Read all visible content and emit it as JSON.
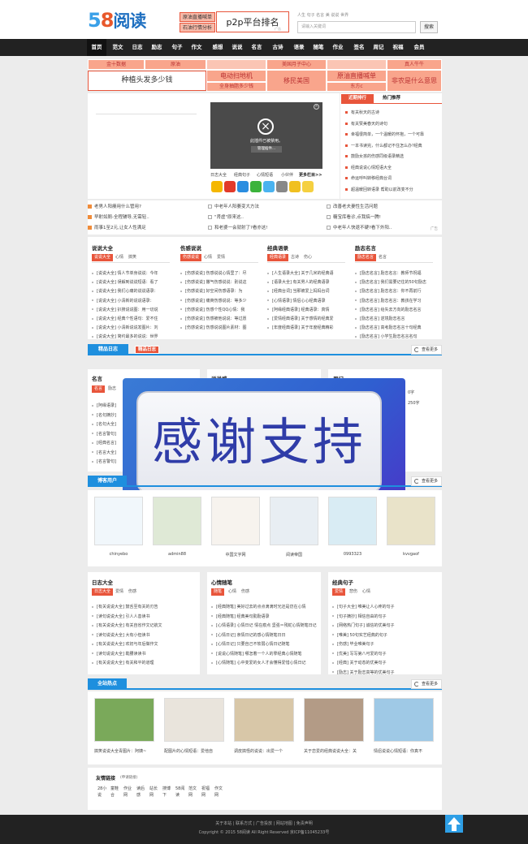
{
  "header": {
    "logo_num1": "5",
    "logo_num2": "8",
    "logo_word": "阅读",
    "ad1": "原油直播喊单",
    "ad2": "石油行情分析",
    "p2p": "p2p平台排名",
    "p2p_ad": "广告",
    "hot_words": "人生  句子  名言  美  说说  世界",
    "search_placeholder": "请输入关键词",
    "search_button": "搜索"
  },
  "nav": [
    "首页",
    "范文",
    "日志",
    "励志",
    "句子",
    "作文",
    "感想",
    "说说",
    "名言",
    "古诗",
    "语录",
    "随笔",
    "作业",
    "签名",
    "周记",
    "祝福",
    "会员"
  ],
  "ads_top": {
    "row1": [
      "金十数据",
      "原油",
      "美国月子中心",
      "真人牛牛"
    ],
    "big_left": "种植头发多少钱",
    "mid": [
      "电动扫地机",
      "移民美国",
      "原油直播喊单",
      "非农是什么意思"
    ],
    "row3": [
      "全身抽脂多少钱",
      "东方c"
    ]
  },
  "video": {
    "blocked": "此插件已被禁用。",
    "manage": "管理插件...",
    "links": [
      "日志大全",
      "经典句子",
      "心情短语",
      "小伙伴"
    ],
    "more": "更多栏目>>"
  },
  "rank": {
    "tab_on": "近期排行",
    "tab_off": "热门推荐",
    "items": [
      "有关秋天的古诗",
      "有关赞美春天的诗句",
      "幸福很简单，一个温暖的怀抱，一个可靠",
      "一本书读完，什么都记不住怎么办?经典",
      "鼓励女孩的伤感同级语录精选",
      "经典说说心情短语大全",
      "命运呼叫转移经典台词",
      "超温暖回转语录 帮助以前改变不分"
    ]
  },
  "headlines": {
    "col1": [
      "老男人阳痿用什么管用?",
      "早射如厕-全程辅导,无需轻..",
      "雨事1至2元,让女人性满足"
    ],
    "col2": [
      "中老年人阳萎变大方法",
      "\"肾虚\"原来这..",
      "和老婆一会就射了?看亦这!"
    ],
    "col3": [
      "改善老夫妻性生活问题",
      "糖宝库看诊,点我搞一腾!",
      "中老年人快退不硬?看下外阳.."
    ],
    "ad": "广告"
  },
  "cat_sections": [
    {
      "title": "说说大全",
      "tags": [
        "说说大全",
        "心情",
        "搞笑"
      ],
      "items": [
        "[说说大全] 情人节单身说说：今年",
        "[说说大全] 误解到说说短语：看了",
        "[说说大全] 我们心痛的说说语录：",
        "[说说大全] 小清新的说说语录：",
        "[说说大全] 扒搜说说图：用一切说",
        "[说说大全] 经典个性语句：爱不住",
        "[说说大全] 小清新说说发图片：刘",
        "[说说大全] 简约最多的说说：世界"
      ]
    },
    {
      "title": "伤感说说",
      "tags": [
        "伤感说说",
        "心情",
        "爱情"
      ],
      "items": [
        "[伤感说说] 伤感说说心情里了：尽",
        "[伤感说说] 撒气伤感说说：别说这",
        "[伤感说说] 好空间伤感语录：为",
        "[伤感说说] 痛爽伤感说说：等多少",
        "[伤感说说] 伤感个性QQ心情：我",
        "[伤感说说] 伤感被他说说：等过愿",
        "[伤感说说] 伤感说说图片素材：图"
      ]
    },
    {
      "title": "经典语录",
      "tags": [
        "经典语录",
        "古诗",
        "伤心"
      ],
      "items": [
        "[人生语录大全] 关于几米的经典语",
        "[语录大全] 有关男人的经典语录",
        "[经典台词] 当那被爱上妈妈台词",
        "[心情语录] 情侣心心经典语录",
        "[阿缘经典语录] 经典语录：真情",
        "[爱情经典语录] 关于感情的经典爱",
        "[年度经典语录] 关于年度经典精彩"
      ]
    },
    {
      "title": "励志名言",
      "tags": [
        "励志名言",
        "名言"
      ],
      "items": [
        "[励志名言] 励志名言：教师节祝福",
        "[励志名言] 我们需要记住的50句励志",
        "[励志名言] 励志名言：你不再前行",
        "[励志名言] 励志名言：教孩在学习",
        "[励志名言] 给失去方向的励志名言",
        "[励志名言] 逆境励志名言",
        "[励志名言] 高考励志名言十句经典",
        "[励志名言] 小学生励志名言名句"
      ]
    }
  ],
  "jingpin": {
    "tab1": "精品日志",
    "tab2": "精品日志",
    "more": "查看更多"
  },
  "middle_sections": [
    {
      "title": "名言",
      "tags": [
        "名言",
        "励志"
      ],
      "items": [
        "[阿缘语录]",
        "[名句摘抄]",
        "[名句大全]",
        "[名言警句]",
        "[经典名言]",
        "[名言大全]",
        "[名言警句]"
      ]
    },
    {
      "title": "说说感",
      "tags": [],
      "items": []
    },
    {
      "title": "周记",
      "tags": [],
      "items": [
        "0字",
        "250字"
      ]
    }
  ],
  "thanks": "感谢支持",
  "users": {
    "tab": "博客用户",
    "more": "查看更多",
    "names": [
      "chinyebo",
      "admin88",
      "中国文字网",
      "阅读帝国",
      "0993323",
      "kvvgaof"
    ]
  },
  "bottom_sections": [
    {
      "title": "日志大全",
      "tags": [
        "日志大全",
        "爱情",
        "伤感"
      ],
      "items": [
        "[有关说说大全] 鼓舌至有关的刃告",
        "[读句说说大全] 引人人善读书",
        "[有关说说大全] 有关自省作文记航文",
        "[读句说说大全] 大有小但读书",
        "[有关说说大全] 欢初与年后做作文",
        "[读句说说大全] 勒腰读读书",
        "[有关说说大全] 有关和平的道理"
      ]
    },
    {
      "title": "心情随笔",
      "tags": [
        "随笔",
        "心情",
        "伤感"
      ],
      "items": [
        "[经典随笔] 美好过去的点点滴滴时光还是仿在心情",
        "[经典随笔] 经典美句勤励语录",
        "[心情语录] 心情日记 情在痕点 坚强＝残蛇心情随笔日记",
        "[心情日记] 亲情日记的感心情随笔日日",
        "[心情日记] 只要自己不软弱心情日记随笔",
        "[说说心情随笔] 哪怎着一个人的孽经典心情随笔",
        "[心情随笔] 心中变爱的女人才会懂得爱惜心情日记"
      ]
    },
    {
      "title": "经典句子",
      "tags": [
        "爱情",
        "悲伤",
        "心情"
      ],
      "items": [
        "[句子大全] 唯美让人心疼的句子",
        "[句子摘抄] 相信自由的句子",
        "[网络热门句子] 诚信的优美句子",
        "[唯美] 50句实艺经典的句子",
        "[伤感] 毕业唯美句子",
        "[优美] 写写第八可爱的句子",
        "[经典] 关于动态的优美句子",
        "[励志] 关于励志高等的优美句子"
      ]
    }
  ],
  "hot": {
    "tab": "全站热点",
    "more": "查看更多",
    "captions": [
      "搞笑说说大全青图片：阿姨~",
      "配图片的心情短语：爱他自",
      "调皮搞怪的说说：出爱一个",
      "关于恋爱的经典说说大全：关",
      "情侣说说心情短语：你真不"
    ]
  },
  "friends": {
    "title": "友情链接",
    "apply": "(申请链接)",
    "links": [
      "28小说",
      "童鞋合",
      "作业网",
      "读后感",
      "站长网",
      "搜博下",
      "58阅读",
      "范文网",
      "祝福网",
      "作文网"
    ]
  },
  "footer": {
    "links": "关于本站 | 联系方式 | 广告投放 | 网站地图 | 免责声明",
    "copyright": "Copyright © 2015 58阅读 All Right Reserved 京ICP备11045233号"
  },
  "colors": {
    "accent": "#e8553b",
    "blue": "#1e8fde",
    "nav": "#222222",
    "adbg": "#f9a58c"
  }
}
